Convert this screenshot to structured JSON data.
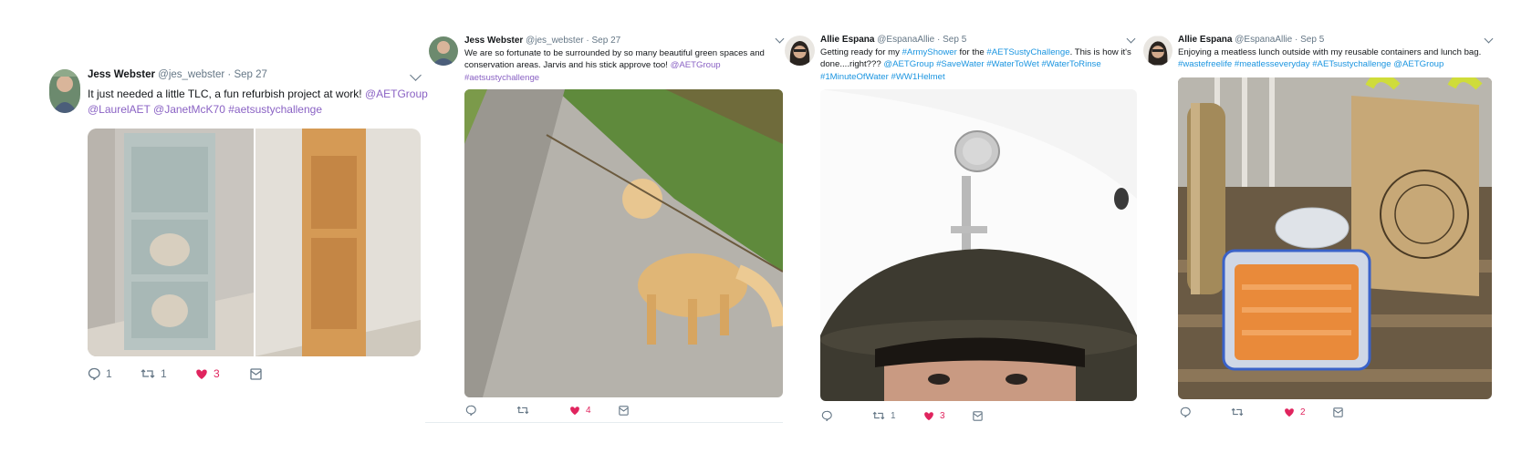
{
  "tweets": [
    {
      "name": "Jess Webster",
      "handle": "@jes_webster",
      "sep": "·",
      "date": "Sep 27",
      "lines": [
        [
          {
            "t": "It just needed a little TLC, a fun refurbish project at work! ",
            "c": "plain"
          },
          {
            "t": "@AETGroup",
            "c": "link"
          }
        ],
        [
          {
            "t": "@LaurelAET",
            "c": "link"
          },
          {
            "t": " ",
            "c": "plain"
          },
          {
            "t": "@JanetMcK70",
            "c": "link"
          },
          {
            "t": " ",
            "c": "plain"
          },
          {
            "t": "#aetsustychallenge",
            "c": "link"
          }
        ]
      ],
      "media_desc": "refurbished shelving unit photos",
      "actions": {
        "reply": "1",
        "retweet": "1",
        "like": "3"
      }
    },
    {
      "name": "Jess Webster",
      "handle": "@jes_webster",
      "sep": "·",
      "date": "Sep 27",
      "lines": [
        [
          {
            "t": "We are so fortunate to be surrounded by so many beautiful green spaces and",
            "c": "plain"
          }
        ],
        [
          {
            "t": "conservation areas. Jarvis and his stick approve too! ",
            "c": "plain"
          },
          {
            "t": "@AETGroup",
            "c": "link"
          }
        ],
        [
          {
            "t": "#aetsustychallenge",
            "c": "link"
          }
        ]
      ],
      "media_desc": "golden retriever on gravel trail",
      "actions": {
        "reply": "",
        "retweet": "",
        "like": "4"
      }
    },
    {
      "name": "Allie Espana",
      "handle": "@EspanaAllie",
      "sep": "·",
      "date": "Sep 5",
      "lines": [
        [
          {
            "t": "Getting ready for my ",
            "c": "plain"
          },
          {
            "t": "#ArmyShower",
            "c": "blink"
          },
          {
            "t": " for the ",
            "c": "plain"
          },
          {
            "t": "#AETSustyChallenge",
            "c": "blink"
          },
          {
            "t": ". This is how it's",
            "c": "plain"
          }
        ],
        [
          {
            "t": "done....right??? ",
            "c": "plain"
          },
          {
            "t": "@AETGroup",
            "c": "blink"
          },
          {
            "t": " ",
            "c": "plain"
          },
          {
            "t": "#SaveWater",
            "c": "blink"
          },
          {
            "t": " ",
            "c": "plain"
          },
          {
            "t": "#WaterToWet",
            "c": "blink"
          },
          {
            "t": " ",
            "c": "plain"
          },
          {
            "t": "#WaterToRinse",
            "c": "blink"
          }
        ],
        [
          {
            "t": "#1MinuteOfWater",
            "c": "blink"
          },
          {
            "t": " ",
            "c": "plain"
          },
          {
            "t": "#WW1Helmet",
            "c": "blink"
          }
        ]
      ],
      "media_desc": "selfie under shower head wearing helmet",
      "actions": {
        "reply": "",
        "retweet": "1",
        "like": "3"
      }
    },
    {
      "name": "Allie Espana",
      "handle": "@EspanaAllie",
      "sep": "·",
      "date": "Sep 5",
      "lines": [
        [
          {
            "t": "Enjoying a meatless lunch outside with my reusable containers and lunch bag.",
            "c": "plain"
          }
        ],
        [
          {
            "t": "#wastefreelife",
            "c": "blink"
          },
          {
            "t": " ",
            "c": "plain"
          },
          {
            "t": "#meatlesseveryday",
            "c": "blink"
          },
          {
            "t": " ",
            "c": "plain"
          },
          {
            "t": "#AETsustychallenge",
            "c": "blink"
          },
          {
            "t": " ",
            "c": "plain"
          },
          {
            "t": "@AETGroup",
            "c": "blink"
          }
        ]
      ],
      "media_desc": "reusable bottle, containers with carrots, jute bag",
      "actions": {
        "reply": "",
        "retweet": "",
        "like": "2"
      }
    }
  ],
  "colors": {
    "accent_purple": "#8a62c4",
    "accent_blue": "#1b95e0",
    "like": "#e0245e",
    "muted": "#657786"
  },
  "icons": [
    "reply-icon",
    "retweet-icon",
    "heart-icon",
    "dm-icon",
    "chevron-down-icon"
  ]
}
